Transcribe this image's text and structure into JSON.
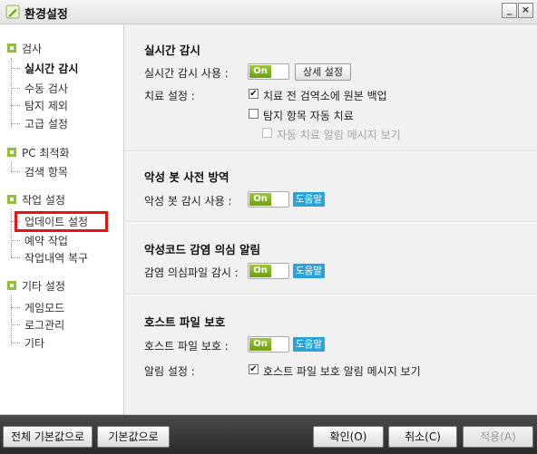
{
  "window": {
    "title": "환경설정",
    "minimize": "_",
    "close": "×"
  },
  "sidebar": {
    "categories": [
      {
        "label": "검사",
        "items": [
          "실시간 감시",
          "수동 검사",
          "탐지 제외",
          "고급 설정"
        ]
      },
      {
        "label": "PC 최적화",
        "items": [
          "검색 항목"
        ]
      },
      {
        "label": "작업 설정",
        "items": [
          "업데이트 설정",
          "예약 작업",
          "작업내역 복구"
        ]
      },
      {
        "label": "기타 설정",
        "items": [
          "게임모드",
          "로그관리",
          "기타"
        ]
      }
    ],
    "active_item": "실시간 감시"
  },
  "realtime": {
    "title": "실시간 감시",
    "use_label": "실시간 감시 사용 :",
    "toggle": "On",
    "detail_button": "상세 설정",
    "treatment_label": "치료 설정 :",
    "options": [
      {
        "label": "치료 전 검역소에 원본 백업",
        "checked": true
      },
      {
        "label": "탐지 항목 자동 치료",
        "checked": false
      },
      {
        "label": "자동 치료 알림 메시지 보기",
        "checked": false
      }
    ]
  },
  "bot": {
    "title": "악성 봇 사전 방역",
    "use_label": "악성 봇 감시 사용 :",
    "toggle": "On",
    "help": "도움말"
  },
  "suspect": {
    "title": "악성코드 감염 의심 알림",
    "use_label": "감염 의심파일 감시 :",
    "toggle": "On",
    "help": "도움말"
  },
  "hosts": {
    "title": "호스트 파일 보호",
    "use_label": "호스트 파일 보호 :",
    "toggle": "On",
    "help": "도움말",
    "alert_label": "알림 설정 :",
    "alert_option": {
      "label": "호스트 파일 보호 알림 메시지 보기",
      "checked": true
    }
  },
  "check_glyph": "✔",
  "footer": {
    "reset_all": "전체 기본값으로",
    "reset": "기본값으로",
    "ok": "확인(O)",
    "cancel": "취소(C)",
    "apply": "적용(A)"
  },
  "colors": {
    "accent_green": "#7aab1c",
    "help_blue": "#2ba3d8",
    "highlight_red": "#e11111"
  }
}
